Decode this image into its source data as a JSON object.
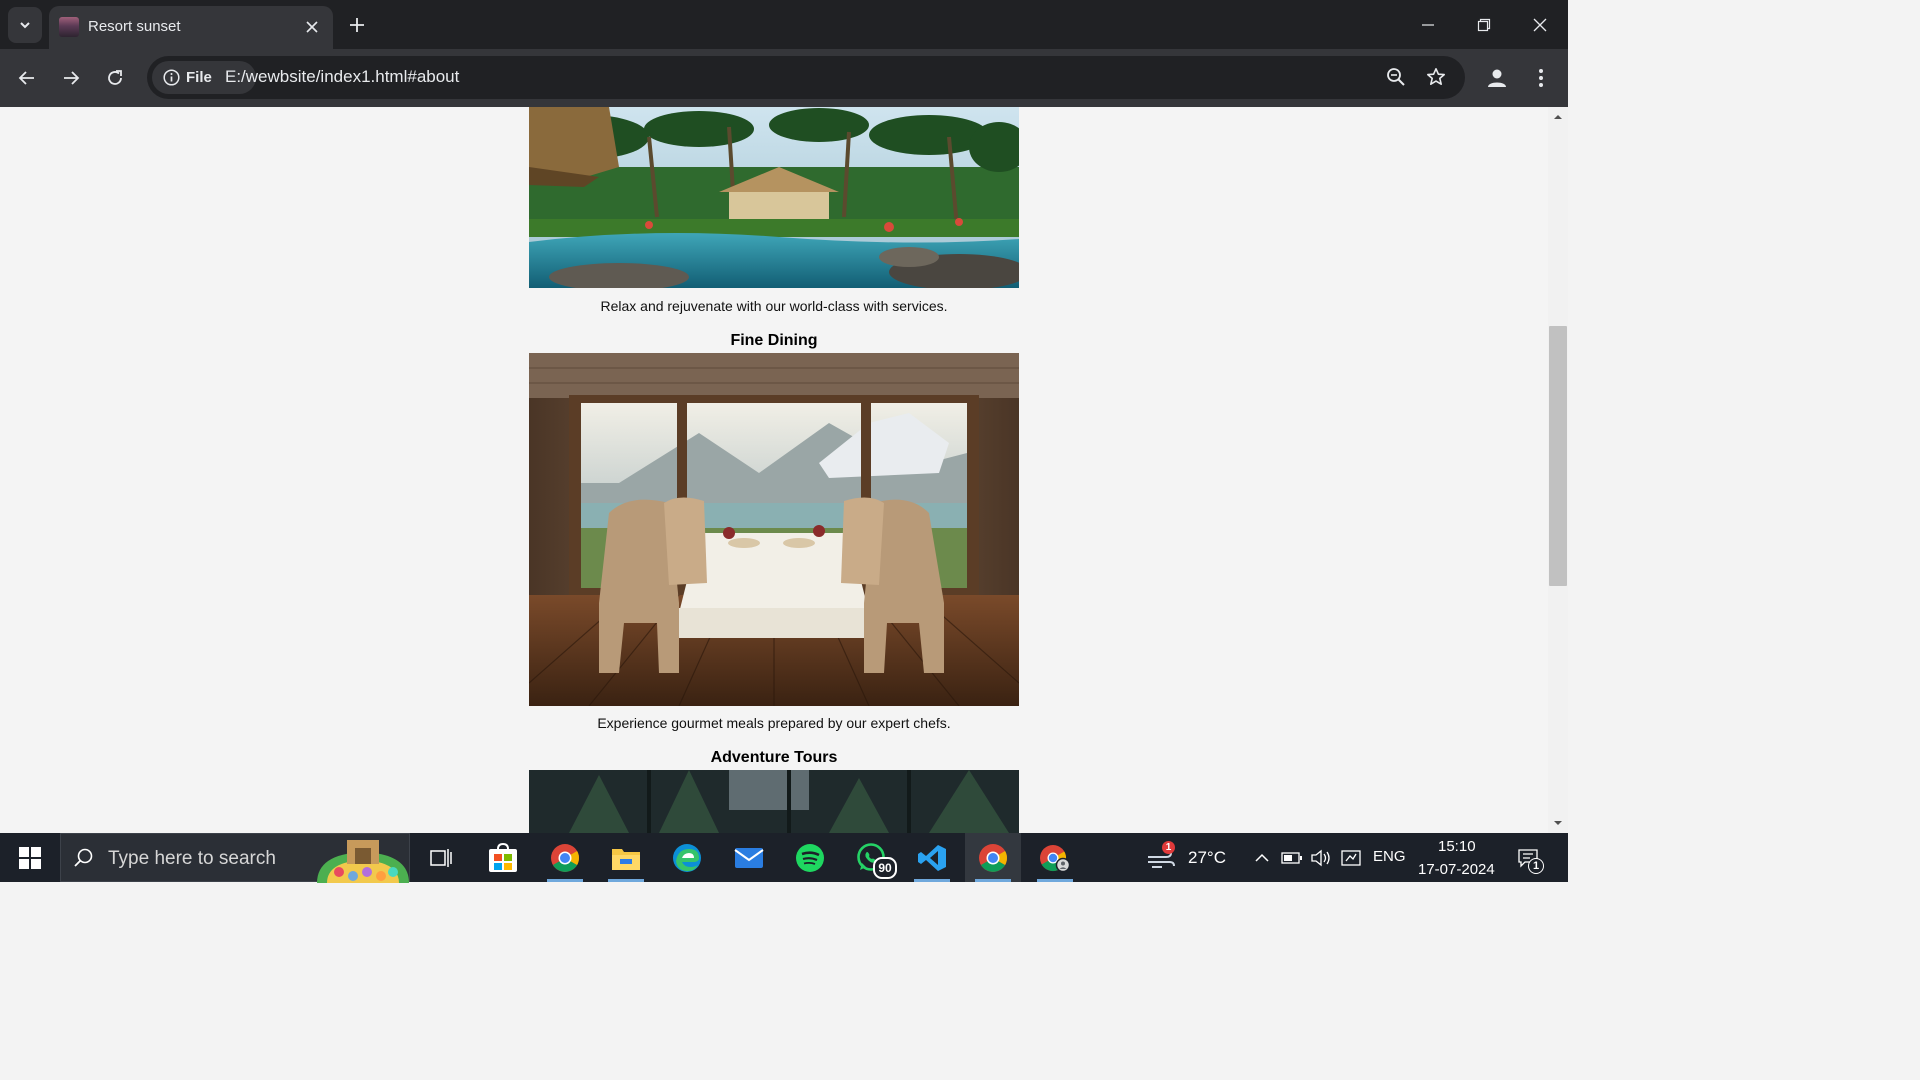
{
  "browser": {
    "tab_title": "Resort sunset",
    "site_chip_label": "File",
    "url": "E:/wewbsite/index1.html#about"
  },
  "page": {
    "spa_caption": "Relax and rejuvenate with our world-class with services.",
    "dining_heading": "Fine Dining",
    "dining_caption": "Experience gourmet meals prepared by our expert chefs.",
    "tours_heading": "Adventure Tours"
  },
  "taskbar": {
    "search_placeholder": "Type here to search",
    "whatsapp_badge": "90",
    "weather_badge": "1",
    "temperature": "27°C",
    "language": "ENG",
    "time": "15:10",
    "date": "17-07-2024",
    "notification_count": "1"
  },
  "colors": {
    "titlebar": "#202124",
    "toolbar": "#35363a",
    "page_background": "#f4f4f4",
    "taskbar": "#1c2129"
  }
}
